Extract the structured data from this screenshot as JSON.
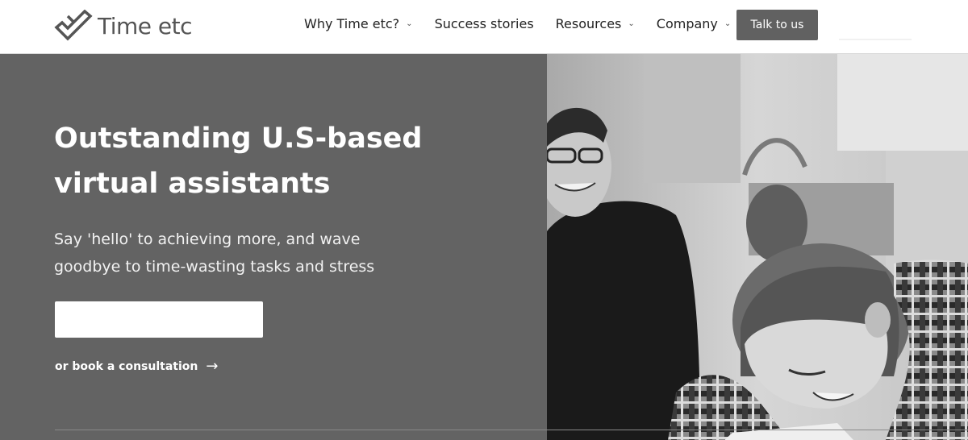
{
  "header": {
    "logo_text": "Time etc",
    "nav": [
      {
        "label": "Why Time etc?",
        "dropdown": true
      },
      {
        "label": "Success stories",
        "dropdown": false
      },
      {
        "label": "Resources",
        "dropdown": true
      },
      {
        "label": "Company",
        "dropdown": true
      }
    ],
    "cta_label": "Talk to us"
  },
  "hero": {
    "title_line1": "Outstanding U.S-based",
    "title_line2": "virtual assistants",
    "subtitle_line1": "Say 'hello' to achieving more, and wave",
    "subtitle_line2": "goodbye to time-wasting tasks and stress",
    "button_label": "",
    "consult_label": "or book a consultation",
    "consult_arrow": "→"
  },
  "colors": {
    "hero_panel": "#636363",
    "cta_button": "#616161",
    "text_dark": "#222222",
    "white": "#ffffff"
  },
  "icons": {
    "logo": "checkmark-logo-icon",
    "dropdown": "chevron-down-icon",
    "arrow": "arrow-right-icon"
  }
}
